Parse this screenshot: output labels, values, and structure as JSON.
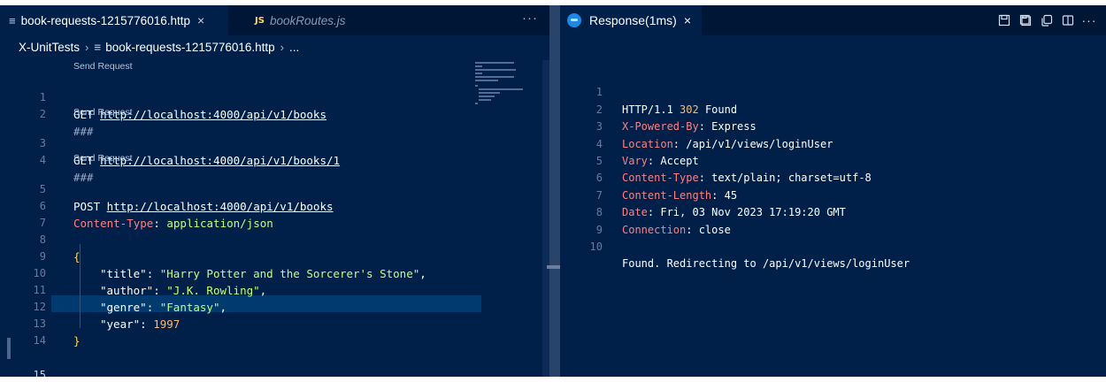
{
  "left": {
    "tabs": [
      {
        "label": "book-requests-1215776016.http",
        "glyph": "≡",
        "close": "×"
      },
      {
        "label": "bookRoutes.js",
        "badge": "JS"
      }
    ],
    "more": "···",
    "breadcrumb": {
      "folder": "X-UnitTests",
      "sep": "›",
      "file_glyph": "≡",
      "file": "book-requests-1215776016.http",
      "tail": "..."
    },
    "send_request": "Send Request",
    "lines": {
      "l1": {
        "num": "1",
        "method": "GET",
        "url": "http://localhost:4000/api/v1/books"
      },
      "l2": {
        "num": "2",
        "text": "###"
      },
      "l3": {
        "num": "3",
        "method": "GET",
        "url": "http://localhost:4000/api/v1/books/1"
      },
      "l4": {
        "num": "4",
        "text": "###"
      },
      "l5": {
        "num": "5",
        "method": "POST",
        "url": "http://localhost:4000/api/v1/books"
      },
      "l6": {
        "num": "6",
        "key": "Content-Type",
        "colon": ": ",
        "value": "application/json"
      },
      "l7": {
        "num": "7"
      },
      "l8": {
        "num": "8",
        "brace": "{"
      },
      "l9": {
        "num": "9",
        "key": "\"title\"",
        "colon": ": ",
        "value": "\"Harry Potter and the Sorcerer's Stone\"",
        "tail": ","
      },
      "l10": {
        "num": "10",
        "key": "\"author\"",
        "colon": ": ",
        "value": "\"J.K. Rowling\"",
        "tail": ","
      },
      "l11": {
        "num": "11",
        "key": "\"genre\"",
        "colon": ": ",
        "value": "\"Fantasy\"",
        "tail": ","
      },
      "l12": {
        "num": "12",
        "key": "\"year\"",
        "colon": ": ",
        "value": "1997"
      },
      "l13": {
        "num": "13",
        "brace": "}"
      },
      "l14": {
        "num": "14"
      },
      "l15": {
        "num": "15",
        "text": "###"
      }
    }
  },
  "right": {
    "tab": {
      "label": "Response(1ms)",
      "close": "×"
    },
    "actions": {
      "save": "▭",
      "copy": "⧉",
      "more": "···"
    },
    "lines": {
      "r1": {
        "num": "1",
        "pre": "HTTP/1.1 ",
        "code": "302",
        "post": " Found"
      },
      "r2": {
        "num": "2",
        "key": "X-Powered-By",
        "colon": ": ",
        "value": "Express"
      },
      "r3": {
        "num": "3",
        "key": "Location",
        "colon": ": ",
        "value": "/api/v1/views/loginUser"
      },
      "r4": {
        "num": "4",
        "key": "Vary",
        "colon": ": ",
        "value": "Accept"
      },
      "r5": {
        "num": "5",
        "key": "Content-Type",
        "colon": ": ",
        "value": "text/plain; charset=utf-8"
      },
      "r6": {
        "num": "6",
        "key": "Content-Length",
        "colon": ": ",
        "value": "45"
      },
      "r7": {
        "num": "7",
        "key": "Date",
        "colon": ": ",
        "value": "Fri, 03 Nov 2023 17:19:20 GMT"
      },
      "r8": {
        "num": "8",
        "key": "Connection",
        "colon": ": ",
        "value": "close"
      },
      "r9": {
        "num": "9"
      },
      "r10": {
        "num": "10",
        "text": "Found. Redirecting to /api/v1/views/loginUser"
      }
    }
  },
  "colors": {
    "editor_bg": "#00204a",
    "tabbar_bg": "#001636",
    "header_key": "#ff8080",
    "string": "#c1ff7a",
    "number": "#ffb86c",
    "brace": "#ffd75a"
  }
}
